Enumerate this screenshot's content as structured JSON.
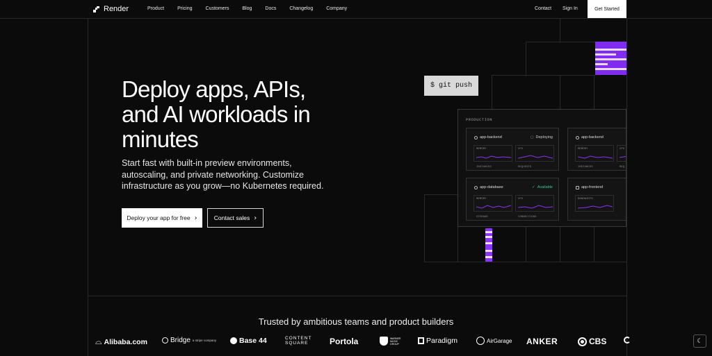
{
  "nav": {
    "brand": "Render",
    "links": [
      "Product",
      "Pricing",
      "Customers",
      "Blog",
      "Docs",
      "Changelog",
      "Company"
    ],
    "contact": "Contact",
    "signin": "Sign In",
    "cta": "Get Started"
  },
  "hero": {
    "title": "Deploy apps, APIs, and AI workloads in minutes",
    "subtitle": "Start fast with built-in preview environments, autoscaling, and private networking. Customize infrastructure as you grow—no Kubernetes required.",
    "primary_button": "Deploy your app for free",
    "secondary_button": "Contact sales"
  },
  "illustration": {
    "command": "$ git push",
    "panel_label": "PRODUCTION",
    "services": [
      {
        "name": "app-backend",
        "status": "Deploying",
        "metrics": [
          {
            "label": "MEMORY",
            "foot": "INSTANCES"
          },
          {
            "label": "CPU",
            "foot": "REQUESTS"
          }
        ]
      },
      {
        "name": "app-backend",
        "status": "",
        "metrics": [
          {
            "label": "MEMORY",
            "foot": "INSTANCES"
          },
          {
            "label": "CPU",
            "foot": "REQ"
          }
        ]
      },
      {
        "name": "app-database",
        "status": "Available",
        "metrics": [
          {
            "label": "MEMORY",
            "foot": "STORAGE"
          },
          {
            "label": "CPU",
            "foot": "CONNECTIONS"
          }
        ]
      },
      {
        "name": "app-frontend",
        "status": "",
        "metrics": [
          {
            "label": "BANDWIDTH",
            "foot": ""
          }
        ]
      }
    ],
    "accent_color": "#8c33ff",
    "status_ok_color": "#39c59b"
  },
  "trusted": {
    "heading": "Trusted by ambitious teams and product builders",
    "logos": [
      "Alibaba.com",
      "Bridge",
      "a stripe company",
      "Base 44",
      "CONTENT",
      "SQUARE",
      "Portola",
      "WARNER MUSIC GROUP",
      "Paradigm",
      "AirGarage",
      "ANKER",
      "CBS"
    ]
  },
  "theme_toggle_icon": "moon-icon"
}
